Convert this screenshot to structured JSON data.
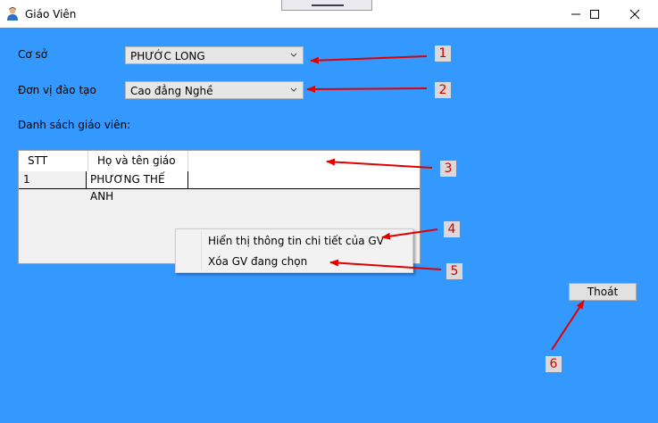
{
  "window": {
    "title": "Giáo Viên",
    "app_icon": "teacher-person-icon",
    "controls": [
      "minimize-icon",
      "maximize-icon",
      "close-icon"
    ]
  },
  "form": {
    "campus_label": "Cơ sở",
    "campus_value": "PHƯỚC LONG",
    "unit_label": "Đơn vị đào tạo",
    "unit_value": "Cao đẳng Nghề",
    "list_label": "Danh sách giáo viên:"
  },
  "table": {
    "columns": [
      "STT",
      "Họ và tên giáo viên"
    ],
    "rows": [
      [
        "1",
        "PHƯƠNG THẾ ANH"
      ]
    ]
  },
  "context_menu": {
    "items": [
      "Hiển thị thông tin chi tiết của GV",
      "Xóa GV đang chọn"
    ]
  },
  "buttons": {
    "exit": "Thoát"
  },
  "annotations": [
    "1",
    "2",
    "3",
    "4",
    "5",
    "6"
  ],
  "colors": {
    "background": "#3399ff",
    "annotation_arrow": "#e00000"
  }
}
